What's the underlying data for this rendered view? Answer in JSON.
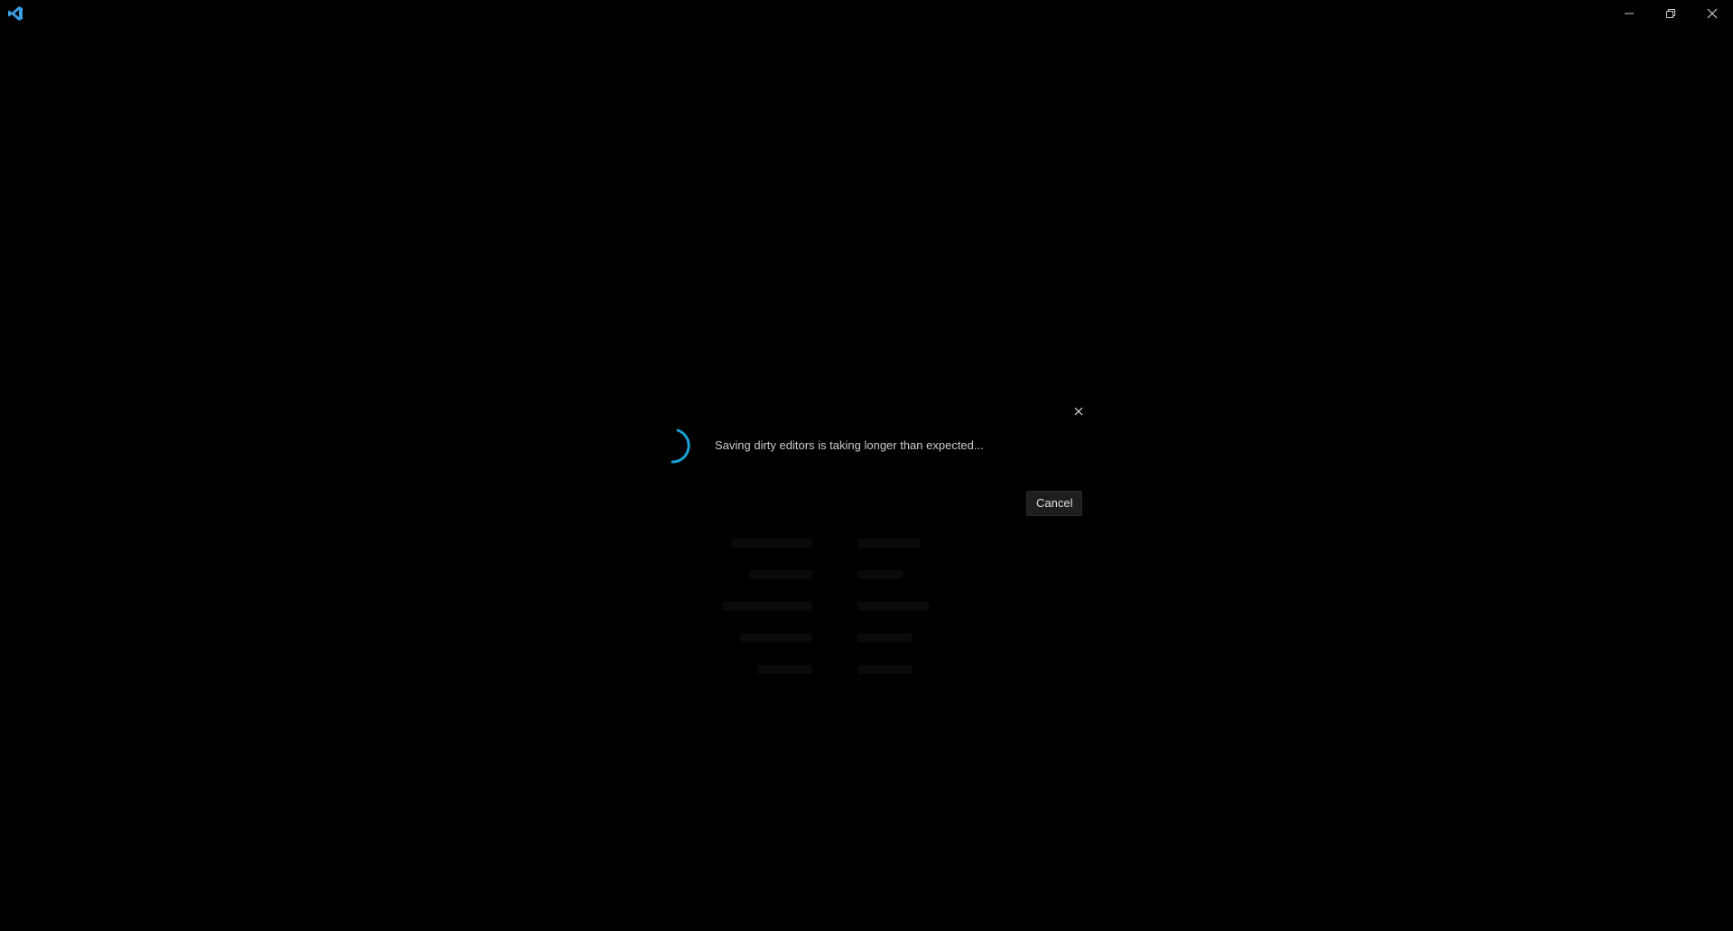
{
  "window": {
    "app_icon": "vscode-logo-icon",
    "controls": {
      "minimize_icon": "minimize-icon",
      "restore_icon": "restore-icon",
      "close_icon": "close-icon"
    }
  },
  "dialog": {
    "message": "Saving dirty editors is taking longer than expected...",
    "cancel_label": "Cancel",
    "close_icon": "close-icon",
    "spinner_icon": "progress-spinner-icon"
  },
  "colors": {
    "background": "#000000",
    "accent": "#1ba1d0",
    "logo": "#3a9fe3",
    "text": "#cccccc"
  }
}
